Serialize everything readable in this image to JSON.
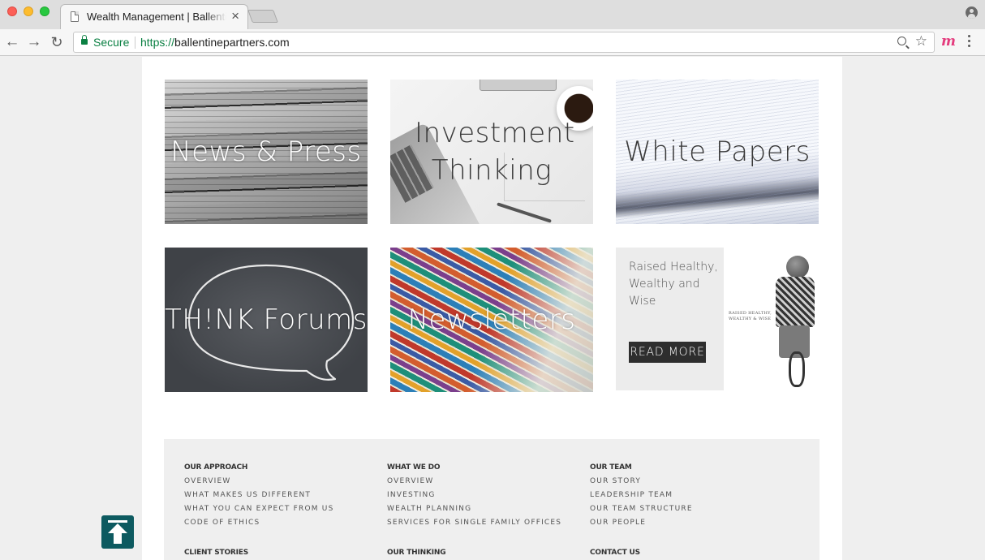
{
  "browser": {
    "tab_title": "Wealth Management | Ballentine Partners",
    "tab_close": "×",
    "secure_label": "Secure",
    "url_scheme": "https://",
    "url_host": "ballentinepartners.com",
    "extension_glyph": "m"
  },
  "tiles": {
    "news": "News & Press",
    "investment": "Investment Thinking",
    "white_papers": "White Papers",
    "think_forums": "TH!NK Forums",
    "newsletters": "Newsletters"
  },
  "promo": {
    "text": "Raised Healthy, Wealthy and Wise",
    "button": "READ MORE",
    "book_title": "RAISED HEALTHY, WEALTHY & WISE"
  },
  "footer": {
    "columns": [
      {
        "heading": "OUR APPROACH",
        "links": [
          "OVERVIEW",
          "WHAT MAKES US DIFFERENT",
          "WHAT YOU CAN EXPECT FROM US",
          "CODE OF ETHICS"
        ]
      },
      {
        "heading": "WHAT WE DO",
        "links": [
          "OVERVIEW",
          "INVESTING",
          "WEALTH PLANNING",
          "SERVICES FOR SINGLE FAMILY OFFICES"
        ]
      },
      {
        "heading": "OUR TEAM",
        "links": [
          "OUR STORY",
          "LEADERSHIP TEAM",
          "OUR TEAM STRUCTURE",
          "OUR PEOPLE"
        ]
      }
    ],
    "second_row": [
      "CLIENT STORIES",
      "OUR THINKING",
      "CONTACT US"
    ]
  },
  "colors": {
    "accent": "#0d5a60",
    "secure_green": "#0b8043",
    "promo_button": "#2e2e2e"
  }
}
